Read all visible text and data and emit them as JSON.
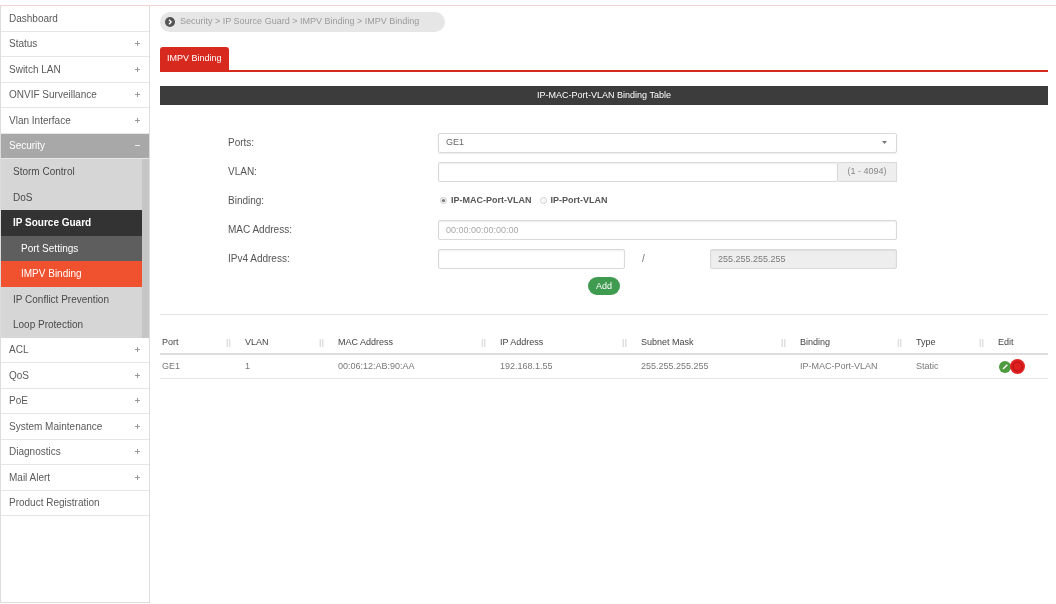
{
  "sidebar": {
    "items": [
      {
        "label": "Dashboard",
        "kind": "link",
        "selected": false
      },
      {
        "label": "Status",
        "kind": "group",
        "expanded": false
      },
      {
        "label": "Switch LAN",
        "kind": "group",
        "expanded": false
      },
      {
        "label": "ONVIF Surveillance",
        "kind": "group",
        "expanded": false
      },
      {
        "label": "Vlan Interface",
        "kind": "group",
        "expanded": false
      },
      {
        "label": "Security",
        "kind": "group",
        "expanded": true,
        "children": [
          {
            "label": "Storm Control",
            "selected": false
          },
          {
            "label": "DoS",
            "selected": false
          },
          {
            "label": "IP Source Guard",
            "expanded": true,
            "children": [
              {
                "label": "Port Settings",
                "selected": false
              },
              {
                "label": "IMPV Binding",
                "selected": true
              }
            ]
          },
          {
            "label": "IP Conflict Prevention",
            "selected": false
          },
          {
            "label": "Loop Protection",
            "selected": false
          }
        ]
      },
      {
        "label": "ACL",
        "kind": "group",
        "expanded": false
      },
      {
        "label": "QoS",
        "kind": "group",
        "expanded": false
      },
      {
        "label": "PoE",
        "kind": "group",
        "expanded": false
      },
      {
        "label": "System Maintenance",
        "kind": "group",
        "expanded": false
      },
      {
        "label": "Diagnostics",
        "kind": "group",
        "expanded": false
      },
      {
        "label": "Mail Alert",
        "kind": "group",
        "expanded": false
      },
      {
        "label": "Product Registration",
        "kind": "link",
        "selected": false
      }
    ]
  },
  "breadcrumb": {
    "text": "Security > IP Source Guard > IMPV Binding > IMPV Binding"
  },
  "tabs": [
    {
      "label": "IMPV Binding",
      "selected": true
    }
  ],
  "panel": {
    "title": "IP-MAC-Port-VLAN Binding Table"
  },
  "form": {
    "fields": [
      {
        "kind": "select",
        "label": "Ports:",
        "value": "GE1"
      },
      {
        "kind": "input",
        "label": "VLAN:",
        "addon": "(1 - 4094)"
      },
      {
        "kind": "radio",
        "label": "Binding:",
        "options": [
          {
            "label": "IP-MAC-Port-VLAN",
            "selected": true
          },
          {
            "label": "IP-Port-VLAN",
            "selected": false
          }
        ]
      },
      {
        "kind": "input",
        "label": "MAC Address:",
        "placeholder": "00:00:00:00:00:00"
      },
      {
        "kind": "ip",
        "label": "IPv4 Address:",
        "separator": "/",
        "mask": {
          "placeholder": "255.255.255.255",
          "disabled": true
        }
      }
    ],
    "add_button": "Add"
  },
  "table": {
    "columns": [
      {
        "label": "Port",
        "sortable": true
      },
      {
        "label": "VLAN",
        "sortable": true
      },
      {
        "label": "MAC Address",
        "sortable": true
      },
      {
        "label": "IP Address",
        "sortable": true
      },
      {
        "label": "Subnet Mask",
        "sortable": true
      },
      {
        "label": "Binding",
        "sortable": true
      },
      {
        "label": "Type",
        "sortable": true
      },
      {
        "label": "Edit",
        "sortable": false
      }
    ],
    "rows": [
      {
        "cells": [
          "GE1",
          "1",
          "00:06:12:AB:90:AA",
          "192.168.1.55",
          "255.255.255.255",
          "IP-MAC-Port-VLAN",
          "Static"
        ]
      }
    ]
  }
}
